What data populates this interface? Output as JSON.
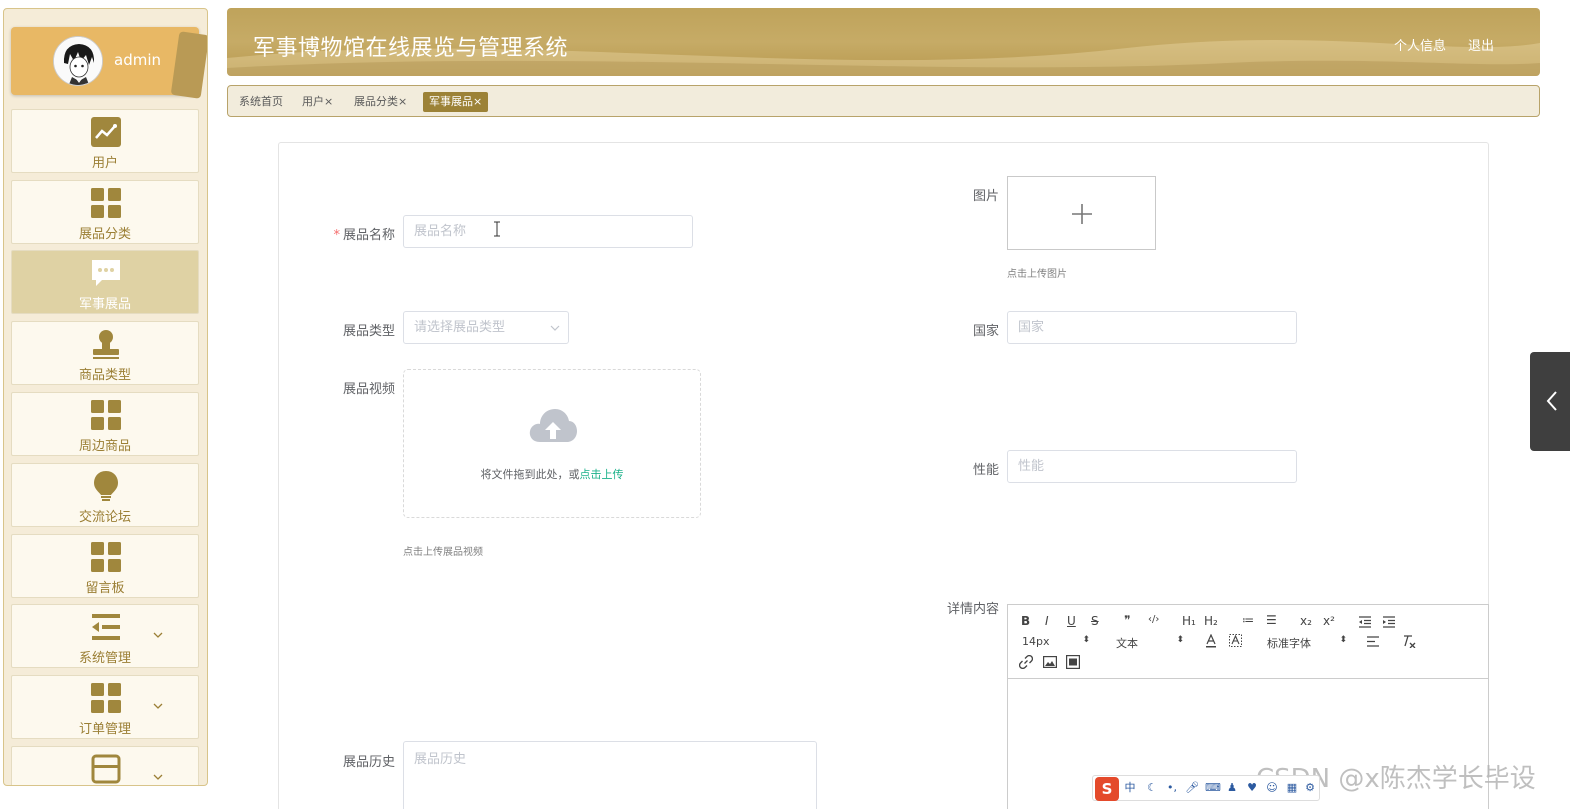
{
  "user": {
    "name": "admin"
  },
  "sidebar": {
    "items": [
      {
        "label": "用户",
        "icon": "trend-chart-icon"
      },
      {
        "label": "展品分类",
        "icon": "grid-icon"
      },
      {
        "label": "军事展品",
        "icon": "chat-bubble-icon"
      },
      {
        "label": "商品类型",
        "icon": "stamp-icon"
      },
      {
        "label": "周边商品",
        "icon": "grid-icon"
      },
      {
        "label": "交流论坛",
        "icon": "lightbulb-icon"
      },
      {
        "label": "留言板",
        "icon": "grid-icon"
      },
      {
        "label": "系统管理",
        "icon": "menu-indent-icon"
      },
      {
        "label": "订单管理",
        "icon": "grid-icon"
      }
    ]
  },
  "header": {
    "title": "军事博物馆在线展览与管理系统",
    "profile_link": "个人信息",
    "logout_link": "退出"
  },
  "tabs": [
    {
      "label": "系统首页"
    },
    {
      "label": "用户"
    },
    {
      "label": "展品分类"
    },
    {
      "label": "军事展品"
    }
  ],
  "tab_close_glyph": "×",
  "form": {
    "name": {
      "label": "展品名称",
      "placeholder": "展品名称"
    },
    "image": {
      "label": "图片",
      "hint": "点击上传图片"
    },
    "type": {
      "label": "展品类型",
      "placeholder": "请选择展品类型"
    },
    "country": {
      "label": "国家",
      "placeholder": "国家"
    },
    "video": {
      "label": "展品视频",
      "drag_text": "将文件拖到此处，或",
      "click_text": "点击上传",
      "hint": "点击上传展品视频"
    },
    "performance": {
      "label": "性能",
      "placeholder": "性能"
    },
    "detail": {
      "label": "详情内容"
    },
    "history": {
      "label": "展品历史",
      "placeholder": "展品历史"
    }
  },
  "editor": {
    "font_size": "14px",
    "text_style": "文本",
    "font_family": "标准字体",
    "buttons_row1": [
      "B",
      "I",
      "U",
      "S",
      "❞",
      "‹/›",
      "H₁",
      "H₂",
      "≔",
      "☰",
      "x₂",
      "x²"
    ]
  },
  "ime": {
    "logo": "S",
    "lang": "中"
  },
  "watermark": "CSDN @x陈杰学长毕设",
  "colors": {
    "accent": "#9c8237",
    "header": "#bfa35b",
    "menu_text": "#9b7f35"
  }
}
